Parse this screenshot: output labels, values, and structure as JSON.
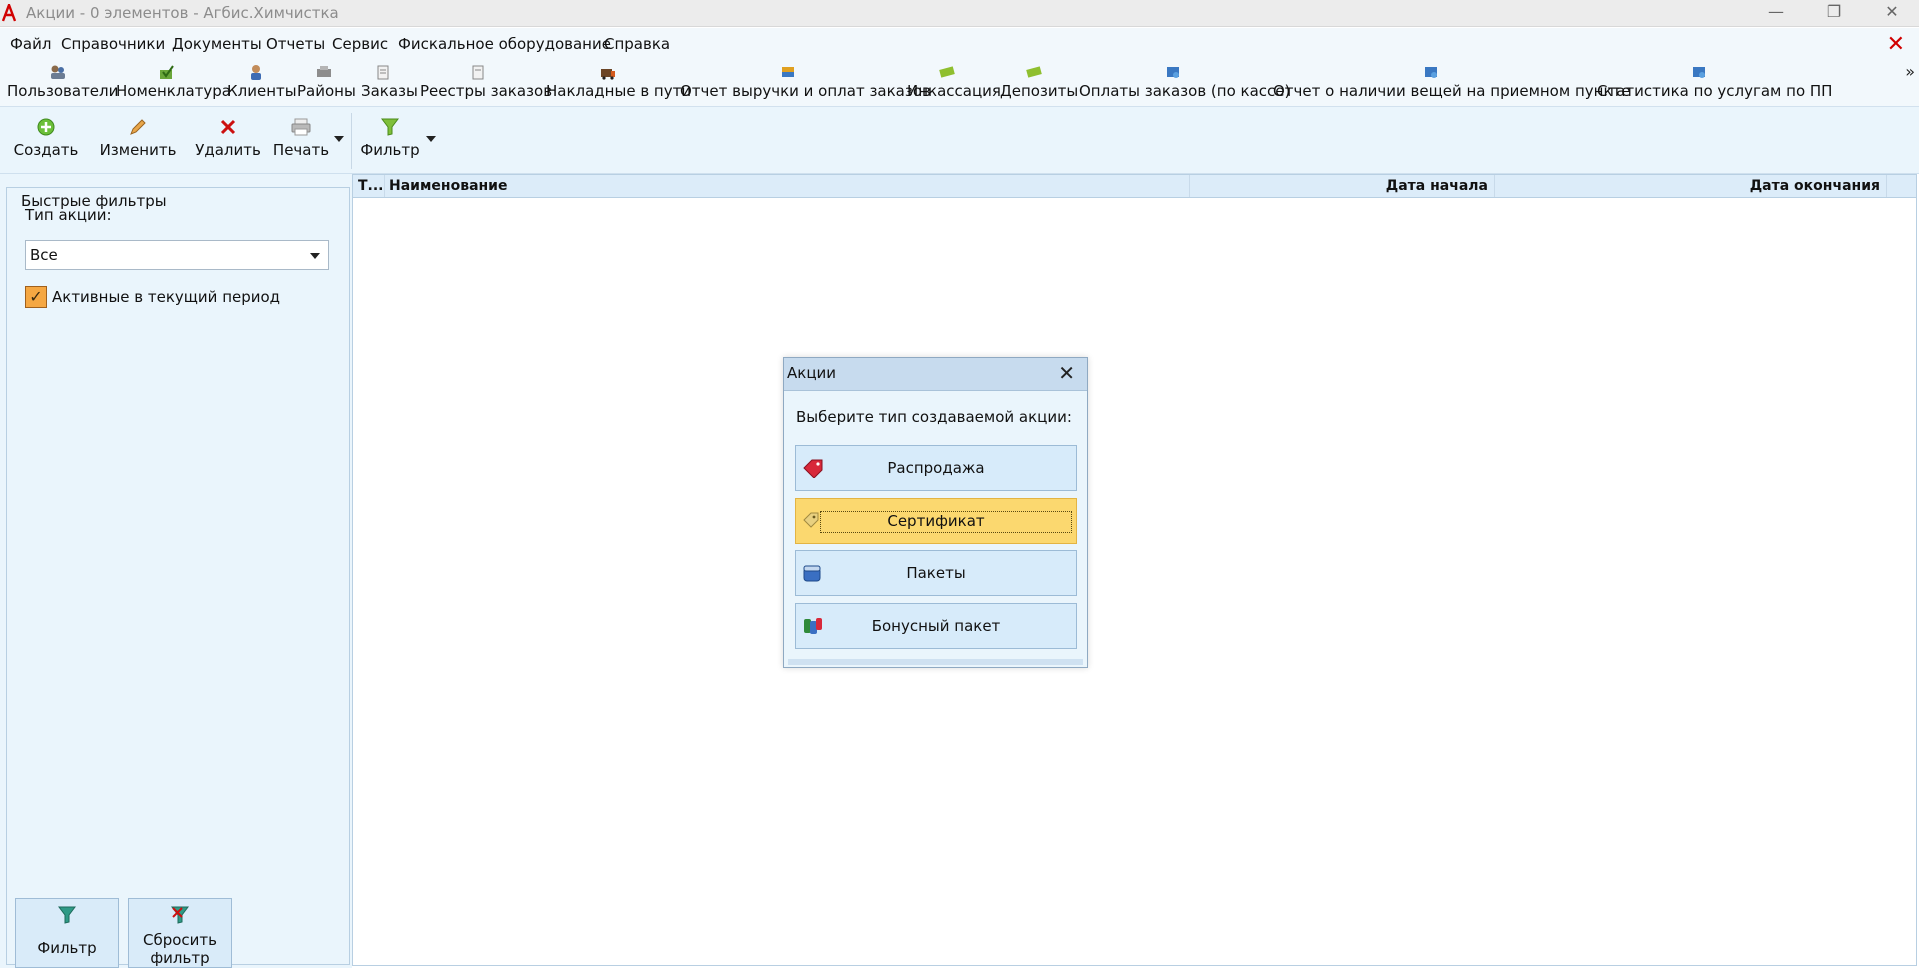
{
  "window": {
    "title": "Акции - 0 элементов - Агбис.Химчистка"
  },
  "menu": [
    "Файл",
    "Справочники",
    "Документы",
    "Отчеты",
    "Сервис",
    "Фискальное оборудование",
    "Справка"
  ],
  "quickbar": [
    {
      "label": "Пользователи",
      "icon": "users-icon"
    },
    {
      "label": "Номенклатура",
      "icon": "nomenclature-icon"
    },
    {
      "label": "Клиенты",
      "icon": "client-icon"
    },
    {
      "label": "Районы",
      "icon": "districts-icon"
    },
    {
      "label": "Заказы",
      "icon": "orders-icon"
    },
    {
      "label": "Реестры заказов",
      "icon": "registry-icon"
    },
    {
      "label": "Накладные в пути",
      "icon": "invoice-icon"
    },
    {
      "label": "Отчет выручки и оплат заказов",
      "icon": "revenue-report-icon"
    },
    {
      "label": "Инкассация",
      "icon": "encashment-icon"
    },
    {
      "label": "Депозиты",
      "icon": "deposit-icon"
    },
    {
      "label": "Оплаты заказов (по кассе)",
      "icon": "payments-icon"
    },
    {
      "label": "Отчет о наличии вещей на приемном пункте",
      "icon": "stock-report-icon"
    },
    {
      "label": "Статистика по услугам по ПП",
      "icon": "statistics-icon"
    }
  ],
  "toolbar": {
    "create": "Создать",
    "edit": "Изменить",
    "delete": "Удалить",
    "print": "Печать",
    "filter": "Фильтр"
  },
  "quick_filters": {
    "title": "Быстрые фильтры",
    "type_label": "Тип акции:",
    "type_value": "Все",
    "active_label": "Активные в текущий период",
    "active_checked": true,
    "filter_button": "Фильтр",
    "reset_button_line1": "Сбросить",
    "reset_button_line2": "фильтр"
  },
  "grid": {
    "columns": [
      "Т...",
      "Наименование",
      "Дата начала",
      "Дата окончания"
    ],
    "rows": []
  },
  "dialog": {
    "title": "Акции",
    "prompt": "Выберите тип создаваемой акции:",
    "options": [
      {
        "label": "Распродажа",
        "icon": "sale-tag-icon"
      },
      {
        "label": "Сертификат",
        "icon": "certificate-icon"
      },
      {
        "label": "Пакеты",
        "icon": "package-icon"
      },
      {
        "label": "Бонусный пакет",
        "icon": "bonus-package-icon"
      }
    ],
    "selected": "Сертификат"
  },
  "colors": {
    "accent_red": "#d10000",
    "highlight": "#fbd86f",
    "panel_bg": "#eaf5fc",
    "checkbox": "#f5a742"
  }
}
